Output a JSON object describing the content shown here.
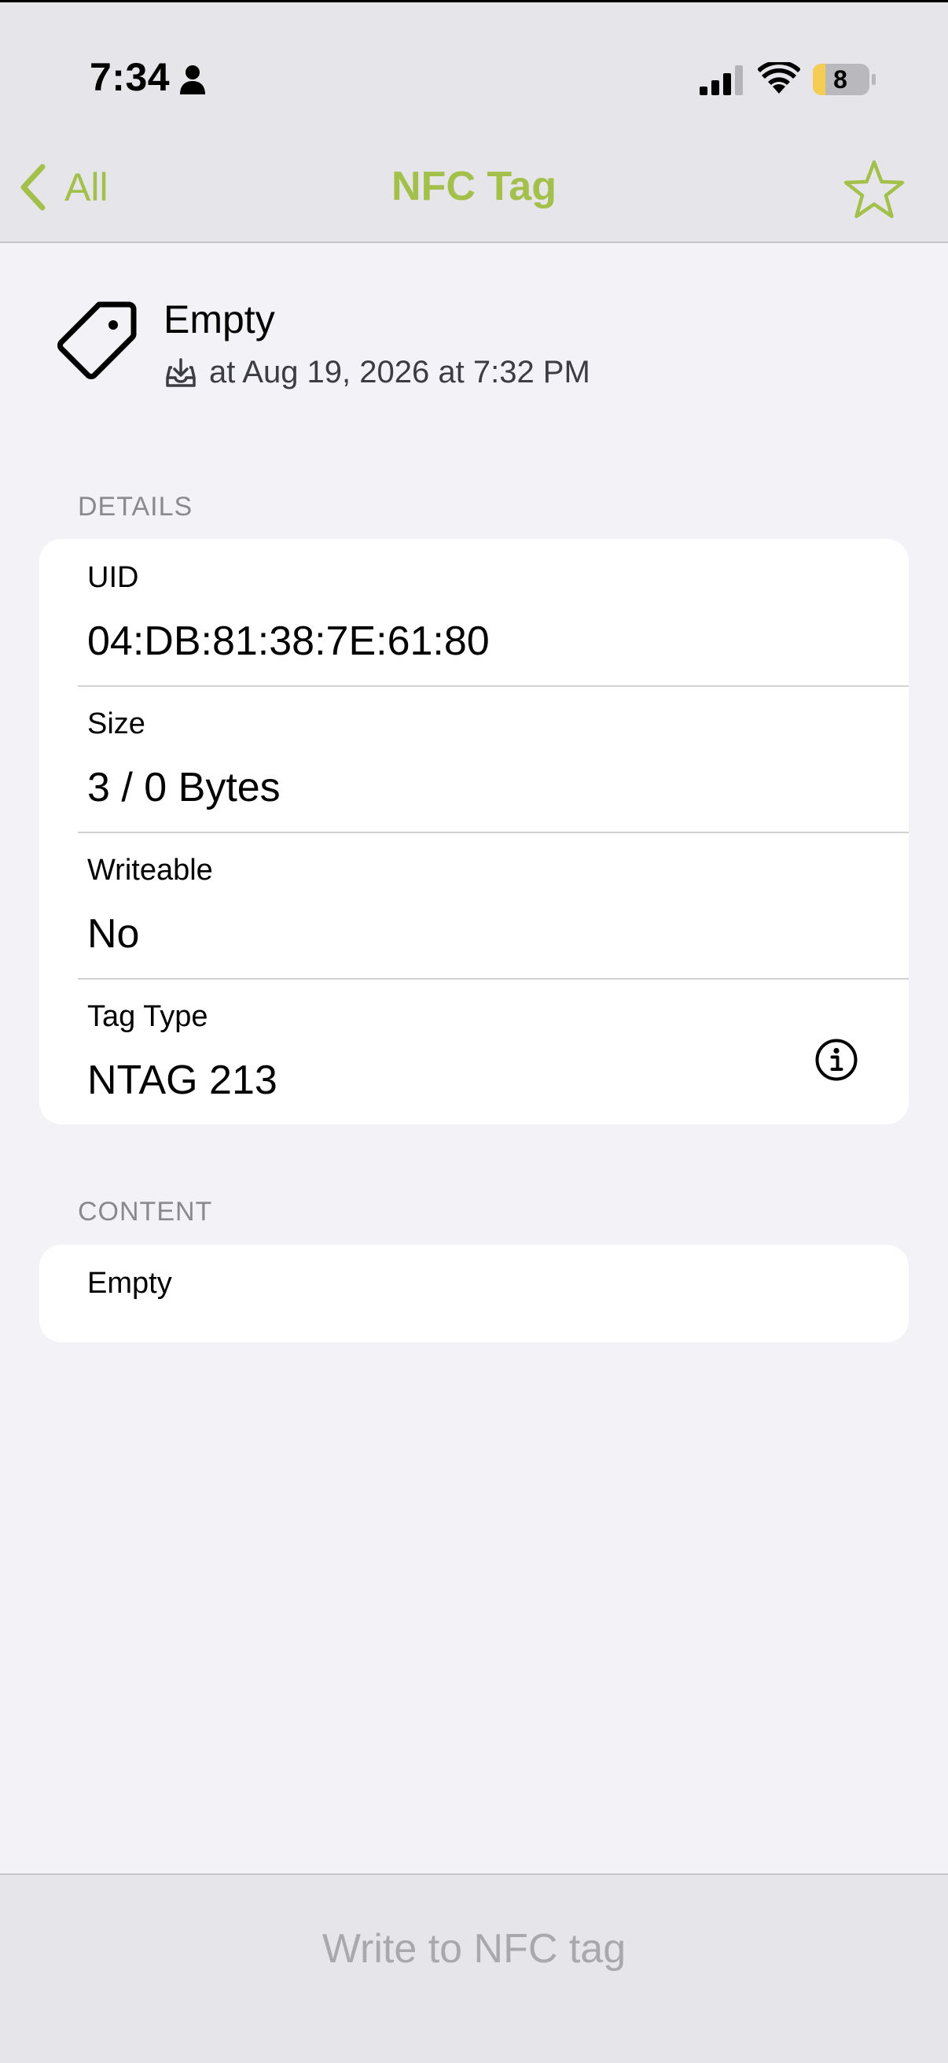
{
  "status_bar": {
    "time": "7:34",
    "battery": "8"
  },
  "nav": {
    "back_label": "All",
    "title": "NFC Tag"
  },
  "summary": {
    "title": "Empty",
    "date": "at Aug 19, 2026 at 7:32 PM"
  },
  "details": {
    "header": "DETAILS",
    "rows": [
      {
        "label": "UID",
        "value": "04:DB:81:38:7E:61:80"
      },
      {
        "label": "Size",
        "value": "3 / 0 Bytes"
      },
      {
        "label": "Writeable",
        "value": "No"
      },
      {
        "label": "Tag Type",
        "value": "NTAG 213"
      }
    ]
  },
  "content": {
    "header": "CONTENT",
    "value": "Empty"
  },
  "toolbar": {
    "write_label": "Write to NFC tag"
  },
  "colors": {
    "accent": "#a3c04a",
    "background": "#f2f2f7",
    "bar": "#e5e5ea",
    "disabled_text": "#a9a9ad"
  },
  "icons": {
    "back": "chevron-left-icon",
    "favorite": "star-icon",
    "tag": "tag-icon",
    "received": "tray-arrow-down-icon",
    "info": "info-circle-icon"
  }
}
